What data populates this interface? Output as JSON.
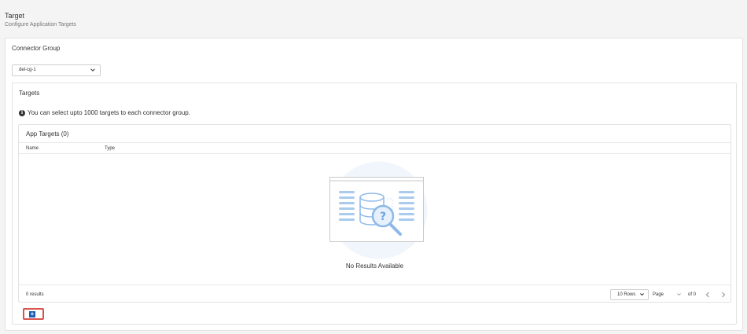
{
  "header": {
    "title": "Target",
    "subtitle": "Configure Application Targets"
  },
  "connector_group": {
    "label": "Connector Group",
    "selected": "del-cg-1"
  },
  "targets": {
    "title": "Targets",
    "info": "You can select upto 1000 targets to each connector group."
  },
  "table": {
    "title": "App Targets (0)",
    "columns": [
      "Name",
      "Type"
    ],
    "empty_text": "No Results Available",
    "footer": {
      "results": "0 results",
      "rows_per_page": "10 Rows",
      "page_label": "Page",
      "of_label": "of 0"
    }
  },
  "colors": {
    "accent": "#1a5fb4",
    "highlight": "#d9534f",
    "illustration": "#a9cbee"
  },
  "icons": {
    "info": "info-icon",
    "dropdown": "chevron-down-icon",
    "prev": "chevron-left-icon",
    "next": "chevron-right-icon",
    "add": "plus-square-icon",
    "empty": "database-search-illustration"
  }
}
